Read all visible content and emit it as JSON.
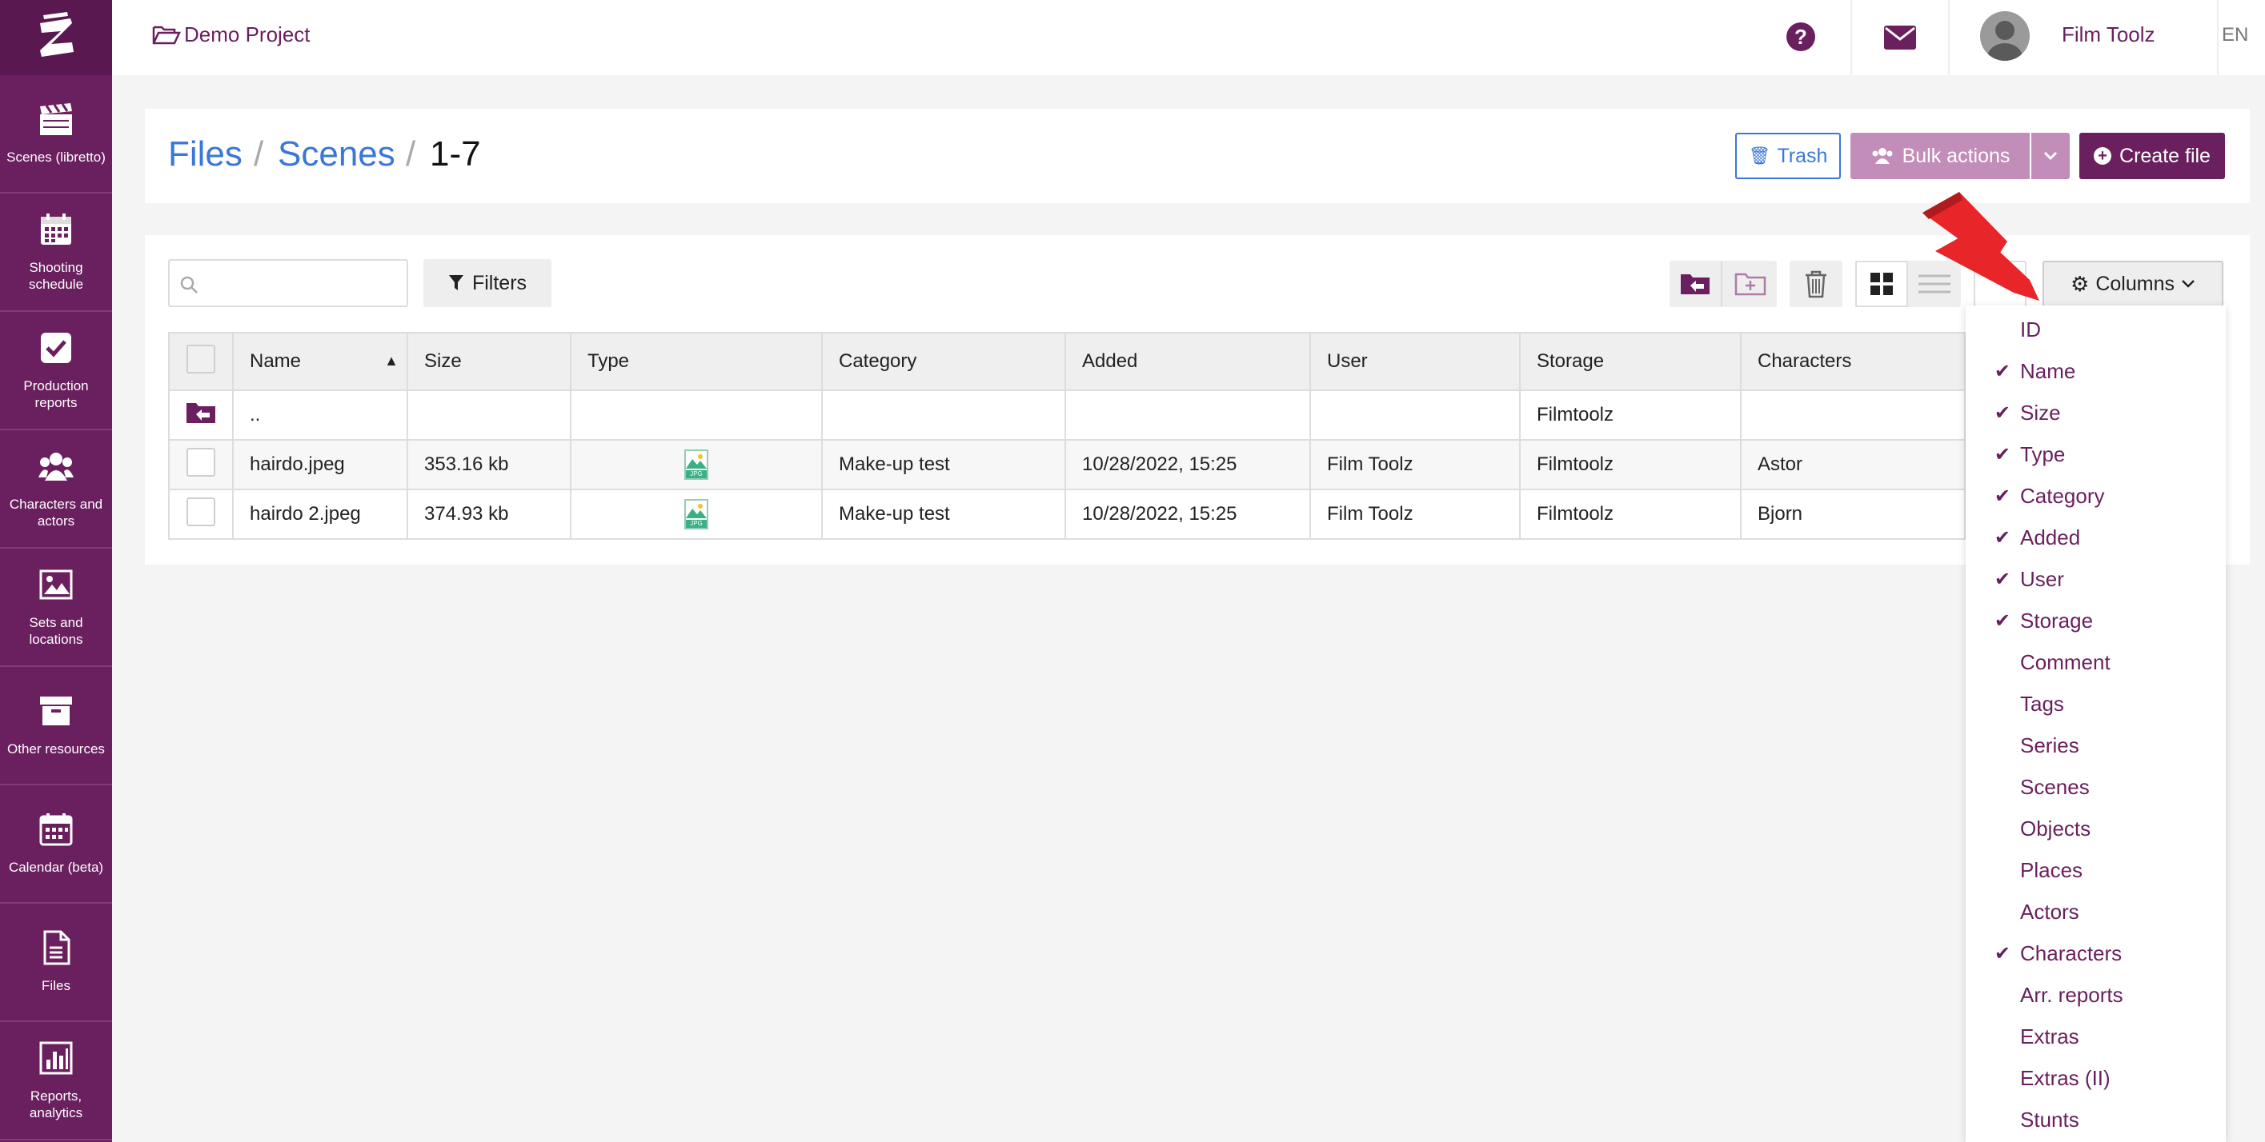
{
  "topbar": {
    "project": "Demo Project",
    "user_name": "Film Toolz",
    "language": "EN"
  },
  "sidebar": {
    "items": [
      {
        "label": "Scenes (libretto)",
        "icon": "clapperboard-icon"
      },
      {
        "label": "Shooting schedule",
        "icon": "calendar-grid-icon"
      },
      {
        "label": "Production reports",
        "icon": "check-square-icon"
      },
      {
        "label": "Characters and actors",
        "icon": "users-icon"
      },
      {
        "label": "Sets and locations",
        "icon": "image-icon"
      },
      {
        "label": "Other resources",
        "icon": "archive-box-icon"
      },
      {
        "label": "Calendar (beta)",
        "icon": "calendar-icon"
      },
      {
        "label": "Files",
        "icon": "file-icon"
      },
      {
        "label": "Reports, analytics",
        "icon": "bar-chart-icon"
      }
    ]
  },
  "breadcrumb": {
    "files": "Files",
    "scenes": "Scenes",
    "current": "1-7",
    "sep": "/"
  },
  "actions": {
    "trash": "Trash",
    "bulk": "Bulk actions",
    "create": "Create file"
  },
  "toolbar": {
    "search_placeholder": "",
    "filters": "Filters",
    "columns": "Columns"
  },
  "table": {
    "headers": [
      "Name",
      "Size",
      "Type",
      "Category",
      "Added",
      "User",
      "Storage",
      "Characters"
    ],
    "parent_row": {
      "name": "..",
      "storage": "Filmtoolz"
    },
    "rows": [
      {
        "name": "hairdo.jpeg",
        "size": "353.16 kb",
        "type": "JPG",
        "category": "Make-up test",
        "added": "10/28/2022, 15:25",
        "user": "Film Toolz",
        "storage": "Filmtoolz",
        "characters": "Astor"
      },
      {
        "name": "hairdo 2.jpeg",
        "size": "374.93 kb",
        "type": "JPG",
        "category": "Make-up test",
        "added": "10/28/2022, 15:25",
        "user": "Film Toolz",
        "storage": "Filmtoolz",
        "characters": "Bjorn"
      }
    ]
  },
  "columns_menu": {
    "items": [
      {
        "label": "ID",
        "checked": false
      },
      {
        "label": "Name",
        "checked": true
      },
      {
        "label": "Size",
        "checked": true
      },
      {
        "label": "Type",
        "checked": true
      },
      {
        "label": "Category",
        "checked": true
      },
      {
        "label": "Added",
        "checked": true
      },
      {
        "label": "User",
        "checked": true
      },
      {
        "label": "Storage",
        "checked": true
      },
      {
        "label": "Comment",
        "checked": false
      },
      {
        "label": "Tags",
        "checked": false
      },
      {
        "label": "Series",
        "checked": false
      },
      {
        "label": "Scenes",
        "checked": false
      },
      {
        "label": "Objects",
        "checked": false
      },
      {
        "label": "Places",
        "checked": false
      },
      {
        "label": "Actors",
        "checked": false
      },
      {
        "label": "Characters",
        "checked": true
      },
      {
        "label": "Arr. reports",
        "checked": false
      },
      {
        "label": "Extras",
        "checked": false
      },
      {
        "label": "Extras (II)",
        "checked": false
      },
      {
        "label": "Stunts",
        "checked": false
      }
    ]
  },
  "colors": {
    "brand": "#6a1f5e",
    "link": "#3a77d9",
    "bulk": "#c28db8",
    "arrow": "#e8262a"
  }
}
